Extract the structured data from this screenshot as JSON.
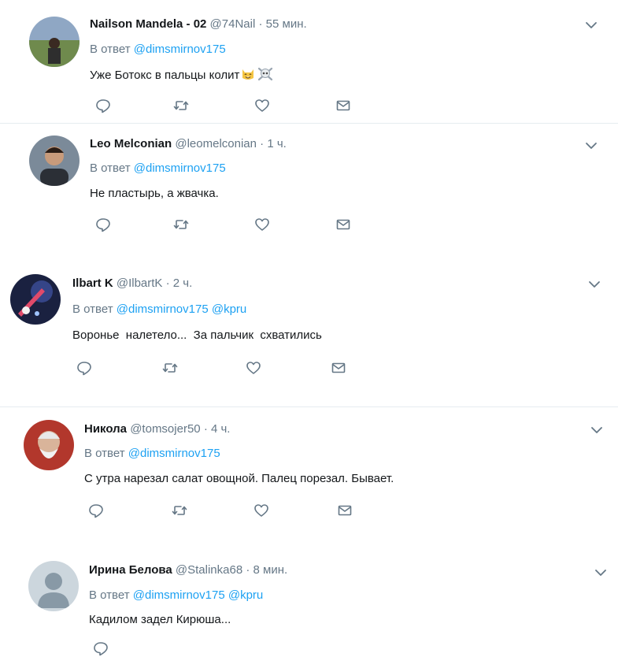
{
  "tweets": [
    {
      "name": "Nailson Mandela - 02",
      "handle": "@74Nail",
      "dot": "·",
      "time": "55 мин.",
      "reply_prefix": "В ответ",
      "mentions": [
        "@dimsmirnov175"
      ],
      "text": "Уже Ботокс в пальцы колит",
      "emoji": [
        "smiling-cat-icon",
        "skull-crossbones-icon"
      ]
    },
    {
      "name": "Leo Melconian",
      "handle": "@leomelconian",
      "dot": "·",
      "time": "1 ч.",
      "reply_prefix": "В ответ",
      "mentions": [
        "@dimsmirnov175"
      ],
      "text": "Не пластырь, а жвачка."
    },
    {
      "name": "Ilbart K",
      "handle": "@IlbartK",
      "dot": "·",
      "time": "2 ч.",
      "reply_prefix": "В ответ",
      "mentions": [
        "@dimsmirnov175",
        "@kpru"
      ],
      "text": "Воронье  налетело...  За пальчик  схватились"
    },
    {
      "name": "Никола",
      "handle": "@tomsojer50",
      "dot": "·",
      "time": "4 ч.",
      "reply_prefix": "В ответ",
      "mentions": [
        "@dimsmirnov175"
      ],
      "text": "С утра нарезал салат овощной. Палец порезал. Бывает."
    },
    {
      "name": "Ирина Белова",
      "handle": "@Stalinka68",
      "dot": "·",
      "time": "8 мин.",
      "reply_prefix": "В ответ",
      "mentions": [
        "@dimsmirnov175",
        "@kpru"
      ],
      "text": "Кадилом задел Кирюша..."
    }
  ],
  "icons": {
    "reply": "reply-icon",
    "retweet": "retweet-icon",
    "like": "heart-icon",
    "dm": "envelope-icon",
    "more": "chevron-down-icon"
  },
  "colors": {
    "link": "#1da1f2",
    "muted": "#657786",
    "text": "#14171a",
    "divider": "#e6ecf0"
  }
}
